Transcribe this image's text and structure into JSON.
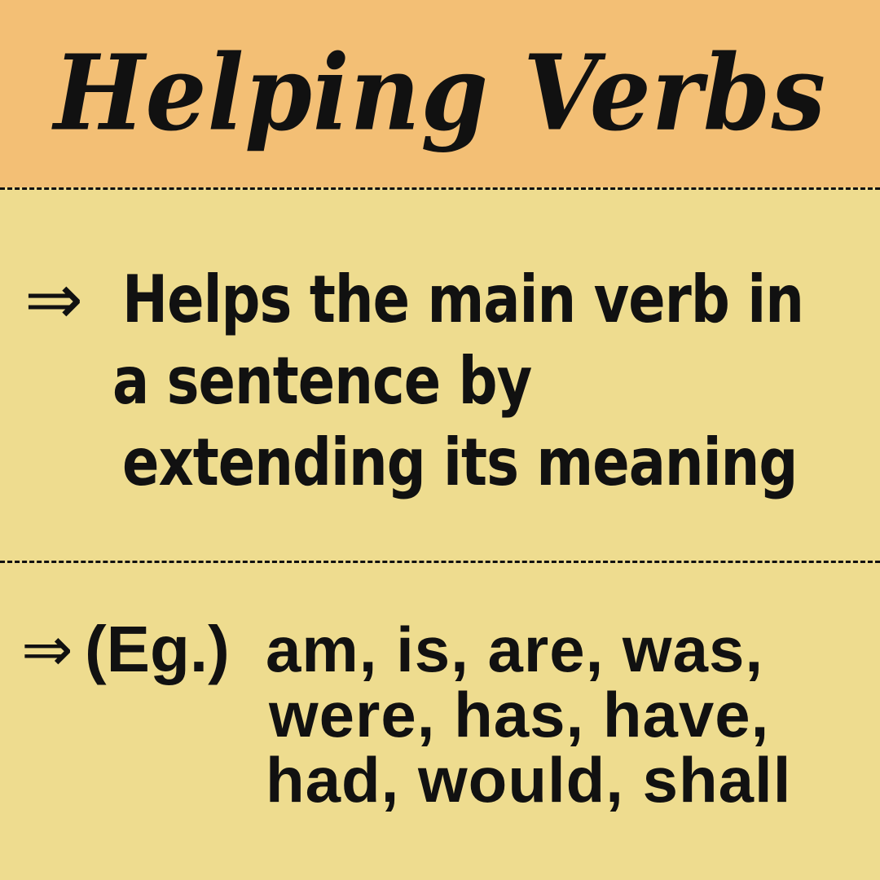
{
  "header": {
    "title": "Helping Verbs"
  },
  "definition": {
    "arrow": "⇒",
    "lines": [
      "Helps the main verb in",
      "a sentence by",
      "extending its meaning"
    ]
  },
  "example": {
    "arrow": "⇒",
    "label": "(Eg.)",
    "lines": [
      "am, is, are, was,",
      "were, has, have,",
      "had, would, shall"
    ]
  },
  "colors": {
    "header_background": "#F3BF75",
    "body_background": "#EEDC8F",
    "text": "#111111"
  }
}
